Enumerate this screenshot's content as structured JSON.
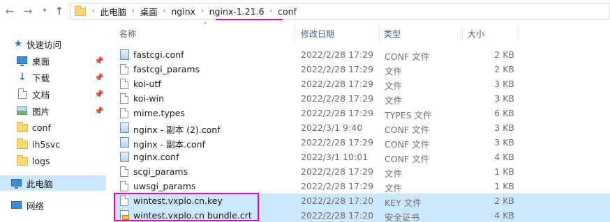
{
  "address": {
    "crumbs": [
      "此电脑",
      "桌面",
      "nginx",
      "nginx-1.21.6",
      "conf"
    ]
  },
  "sidebar": {
    "quick_access": "快速访问",
    "items": [
      {
        "label": "桌面",
        "icon": "desktop-icon",
        "pinned": true
      },
      {
        "label": "下载",
        "icon": "download-icon",
        "pinned": true
      },
      {
        "label": "文档",
        "icon": "document-icon",
        "pinned": true
      },
      {
        "label": "图片",
        "icon": "picture-icon",
        "pinned": true
      },
      {
        "label": "conf",
        "icon": "folder-icon",
        "pinned": false
      },
      {
        "label": "ih5svc",
        "icon": "folder-icon",
        "pinned": false
      },
      {
        "label": "logs",
        "icon": "folder-icon",
        "pinned": false
      }
    ],
    "this_pc": "此电脑",
    "network": "网络"
  },
  "columns": {
    "name": "名称",
    "date": "修改日期",
    "type": "类型",
    "size": "大小"
  },
  "files": [
    {
      "name": "fastcgi.conf",
      "date": "2022/2/28 17:29",
      "type": "CONF 文件",
      "size": "2 KB",
      "icon": "conf-file-icon"
    },
    {
      "name": "fastcgi_params",
      "date": "2022/2/28 17:29",
      "type": "文件",
      "size": "2 KB",
      "icon": "file-icon"
    },
    {
      "name": "koi-utf",
      "date": "2022/2/28 17:29",
      "type": "文件",
      "size": "3 KB",
      "icon": "file-icon"
    },
    {
      "name": "koi-win",
      "date": "2022/2/28 17:29",
      "type": "文件",
      "size": "3 KB",
      "icon": "file-icon"
    },
    {
      "name": "mime.types",
      "date": "2022/2/28 17:29",
      "type": "TYPES 文件",
      "size": "6 KB",
      "icon": "file-icon"
    },
    {
      "name": "nginx - 副本 (2).conf",
      "date": "2022/3/1 9:40",
      "type": "CONF 文件",
      "size": "3 KB",
      "icon": "conf-file-icon"
    },
    {
      "name": "nginx - 副本.conf",
      "date": "2022/2/28 17:29",
      "type": "CONF 文件",
      "size": "3 KB",
      "icon": "conf-file-icon"
    },
    {
      "name": "nginx.conf",
      "date": "2022/3/1 10:01",
      "type": "CONF 文件",
      "size": "4 KB",
      "icon": "conf-file-icon"
    },
    {
      "name": "scgi_params",
      "date": "2022/2/28 17:29",
      "type": "文件",
      "size": "1 KB",
      "icon": "file-icon"
    },
    {
      "name": "uwsgi_params",
      "date": "2022/2/28 17:29",
      "type": "文件",
      "size": "1 KB",
      "icon": "file-icon"
    },
    {
      "name": "wintest.vxplo.cn.key",
      "date": "2022/2/28 17:20",
      "type": "KEY 文件",
      "size": "2 KB",
      "icon": "file-icon"
    },
    {
      "name": "wintest.vxplo.cn bundle.crt",
      "date": "2022/2/28 17:20",
      "type": "安全证书",
      "size": "4 KB",
      "icon": "certificate-icon"
    }
  ],
  "colors": {
    "highlight": "#e000c8",
    "selection": "#cce8ff"
  }
}
